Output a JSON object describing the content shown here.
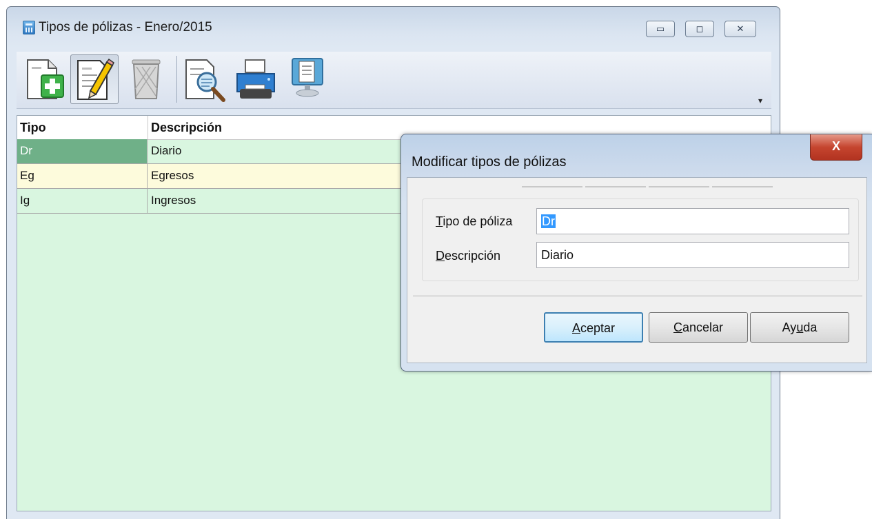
{
  "window": {
    "title": "Tipos de pólizas - Enero/2015",
    "controls": {
      "minimize": "▭",
      "maximize": "◻",
      "close": "✕"
    }
  },
  "toolbar": {
    "buttons": [
      {
        "icon": "new-document-icon"
      },
      {
        "icon": "edit-document-icon"
      },
      {
        "icon": "delete-trash-icon"
      },
      {
        "icon": "preview-magnifier-icon"
      },
      {
        "icon": "printer-icon"
      },
      {
        "icon": "monitor-document-icon"
      }
    ],
    "overflow_glyph": "▾"
  },
  "grid": {
    "headers": [
      "Tipo",
      "Descripción"
    ],
    "rows": [
      {
        "tipo": "Dr",
        "descripcion": "Diario"
      },
      {
        "tipo": "Eg",
        "descripcion": "Egresos"
      },
      {
        "tipo": "Ig",
        "descripcion": "Ingresos"
      }
    ]
  },
  "dialog": {
    "title": "Modificar tipos de pólizas",
    "close_glyph": "X",
    "fields": {
      "tipo": {
        "label_accel": "T",
        "label_rest": "ipo de póliza",
        "value": "Dr"
      },
      "descripcion": {
        "label_accel": "D",
        "label_rest": "escripción",
        "value": "Diario"
      }
    },
    "buttons": {
      "accept": {
        "accel": "A",
        "rest": "ceptar"
      },
      "cancel": {
        "accel": "C",
        "rest": "ancelar"
      },
      "help": {
        "pre": "Ay",
        "accel": "u",
        "rest": "da"
      }
    }
  },
  "colors": {
    "grid_bg": "#d9f6e0",
    "selected_cell": "#6fb088",
    "alt_row": "#fdfbdc",
    "text_selection": "#3399ff"
  }
}
